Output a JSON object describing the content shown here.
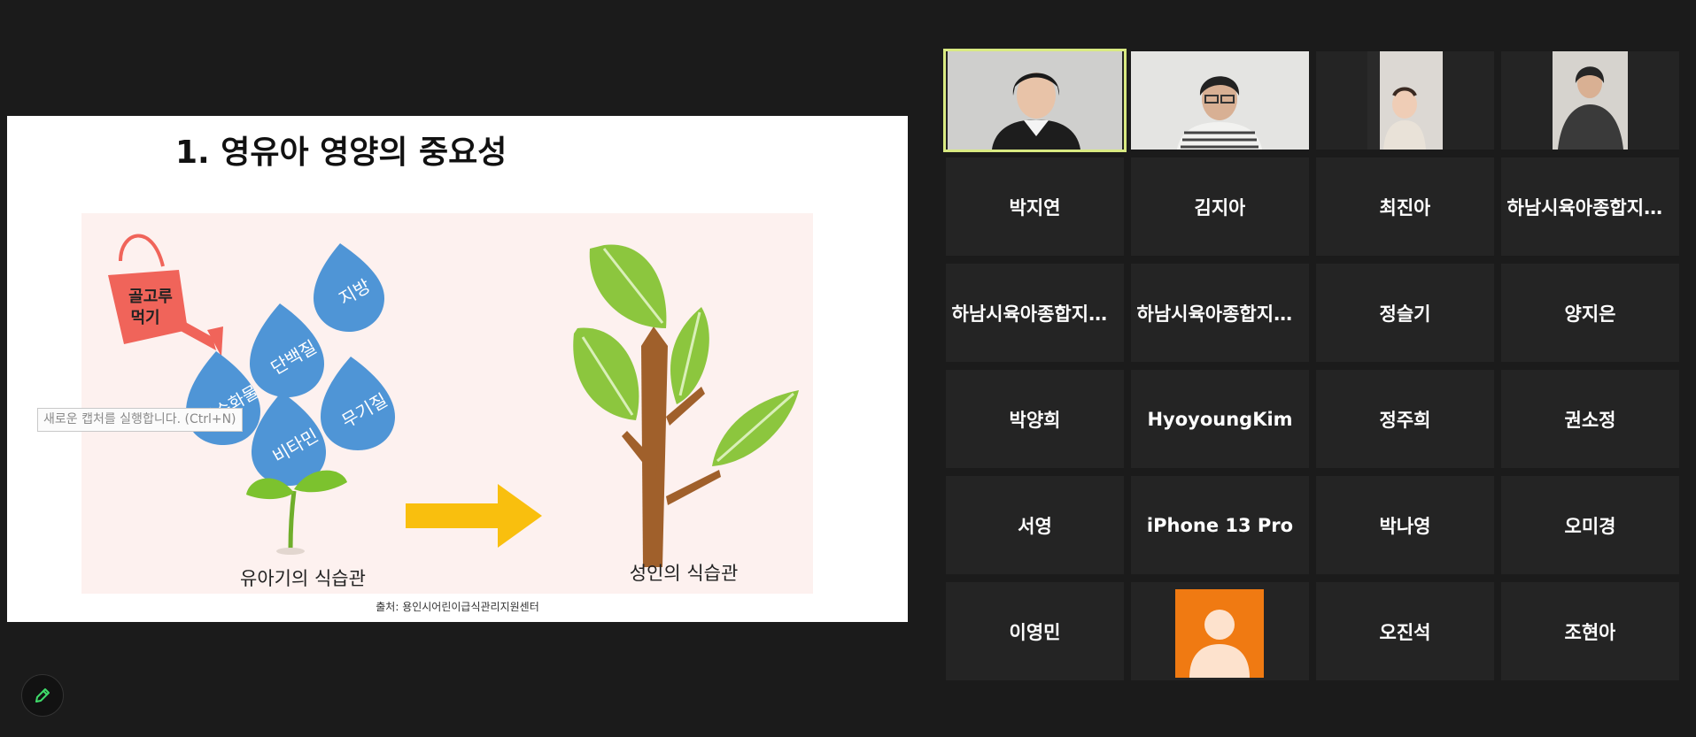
{
  "slide": {
    "title": "1. 영유아 영양의 중요성",
    "source": "출처: 용인시어린이급식관리지원센터",
    "illustration": {
      "can_label_line1": "골고루",
      "can_label_line2": "먹기",
      "drop_labels": [
        "지방",
        "단백질",
        "탄수화물",
        "무기질",
        "비타민"
      ],
      "seedling_caption": "유아기의 식습관",
      "tree_caption": "성인의 식습관"
    }
  },
  "tooltip": "새로운 캡처를 실행합니다. (Ctrl+N)",
  "participants": {
    "video_tiles": [
      {
        "name": "",
        "active": true
      },
      {
        "name": "",
        "active": false
      },
      {
        "name": "",
        "active": false
      },
      {
        "name": "",
        "active": false
      }
    ],
    "names": [
      "박지연",
      "김지아",
      "최진아",
      "하남시육아종합지원센터",
      "하남시육아종합지원센터",
      "하남시육아종합지원센터",
      "정슬기",
      "양지은",
      "박양희",
      "HyoyoungKim",
      "정주희",
      "권소정",
      "서영",
      "iPhone 13 Pro",
      "박나영",
      "오미경",
      "이영민",
      "",
      "오진석",
      "조현아"
    ]
  },
  "colors": {
    "background": "#1b1b1b",
    "tile": "#242424",
    "active_border": "#d9ea82",
    "avatar": "#f07a12",
    "arrow": "#f9bf0e",
    "drop": "#4f95d6",
    "can": "#f0645a"
  },
  "icons": {
    "annotate": "pencil-icon",
    "avatar": "person-avatar-icon"
  }
}
